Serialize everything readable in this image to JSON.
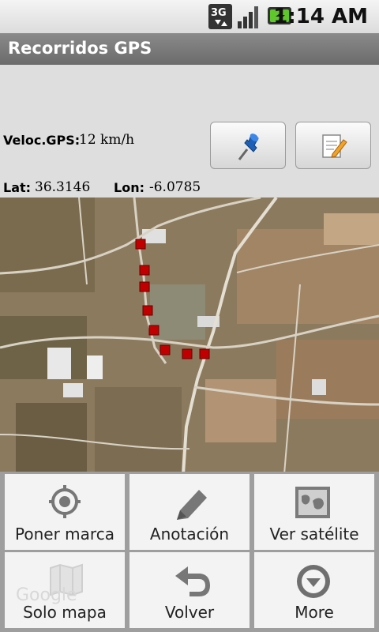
{
  "status_bar": {
    "time": "1:14 AM",
    "network": "3G",
    "icons": [
      "usb-debug-icon",
      "network-3g-icon",
      "signal-icon",
      "battery-charging-icon"
    ]
  },
  "title_bar": {
    "title": "Recorridos GPS"
  },
  "info": {
    "speed_label": "Veloc.GPS:",
    "speed_value": "12 km/h",
    "lat_label": "Lat:",
    "lat_value": "36.3146",
    "lon_label": "Lon:",
    "lon_value": "-6.0785",
    "buttons": [
      {
        "name": "pin-button",
        "icon": "pushpin-icon"
      },
      {
        "name": "notes-button",
        "icon": "notepad-pencil-icon"
      }
    ]
  },
  "map": {
    "road_labels": [],
    "track_color": "#c00000"
  },
  "menu": {
    "items": [
      {
        "label": "Poner marca",
        "icon": "crosshair-icon"
      },
      {
        "label": "Anotación",
        "icon": "pencil-icon"
      },
      {
        "label": "Ver satélite",
        "icon": "satellite-map-icon"
      },
      {
        "label": "Solo mapa",
        "icon": "map-icon"
      },
      {
        "label": "Volver",
        "icon": "back-arrow-icon"
      },
      {
        "label": "More",
        "icon": "more-icon"
      }
    ],
    "watermark": "Google"
  }
}
